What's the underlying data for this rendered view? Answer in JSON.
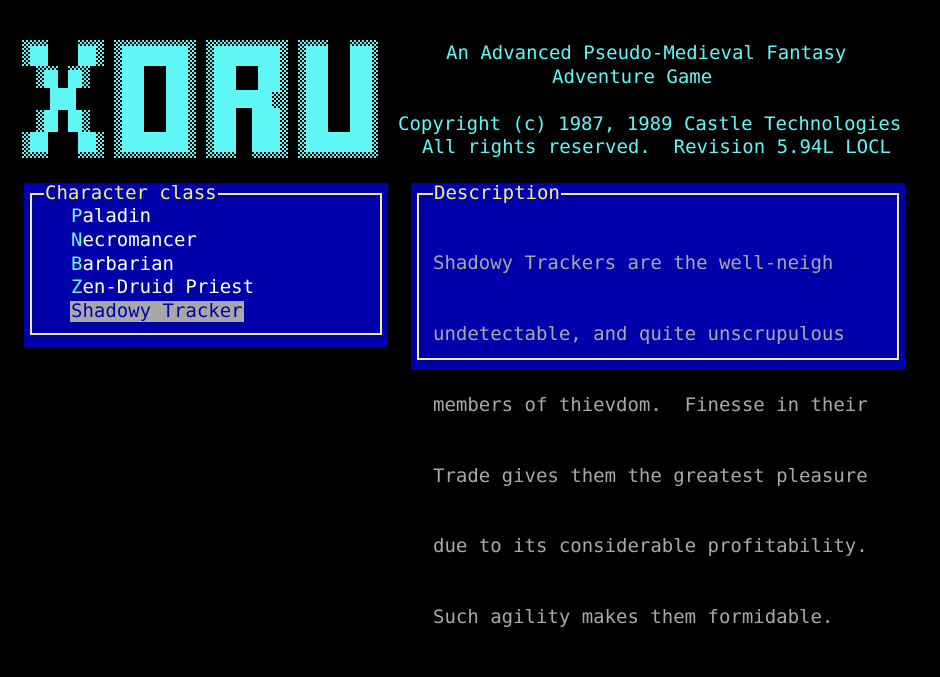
{
  "logo": {
    "text": "XORU",
    "color": "#5ff6f6"
  },
  "header": {
    "tagline_1": "An Advanced Pseudo-Medieval Fantasy",
    "tagline_2": "Adventure Game",
    "copyright": "Copyright (c) 1987, 1989 Castle Technologies",
    "rights": "All rights reserved.  Revision 5.94L LOCL"
  },
  "character_panel": {
    "title": "Character class",
    "items": [
      {
        "hotkey": "P",
        "rest": "aladin",
        "selected": false
      },
      {
        "hotkey": "N",
        "rest": "ecromancer",
        "selected": false
      },
      {
        "hotkey": "B",
        "rest": "arbarian",
        "selected": false
      },
      {
        "hotkey": "Z",
        "rest": "en-Druid Priest",
        "selected": false
      },
      {
        "hotkey": "S",
        "rest": "hadowy Tracker",
        "selected": true
      }
    ]
  },
  "description_panel": {
    "title": "Description",
    "lines": [
      "Shadowy Trackers are the well-neigh",
      "undetectable, and quite unscrupulous",
      "members of thievdom.  Finesse in their",
      "Trade gives them the greatest pleasure",
      "due to its considerable profitability.",
      "Such agility makes them formidable."
    ]
  },
  "colors": {
    "background": "#000000",
    "panel": "#0000aa",
    "frame": "#f2ec8c",
    "header_text": "#5ff6f6",
    "selection": "#a8a8a8"
  }
}
